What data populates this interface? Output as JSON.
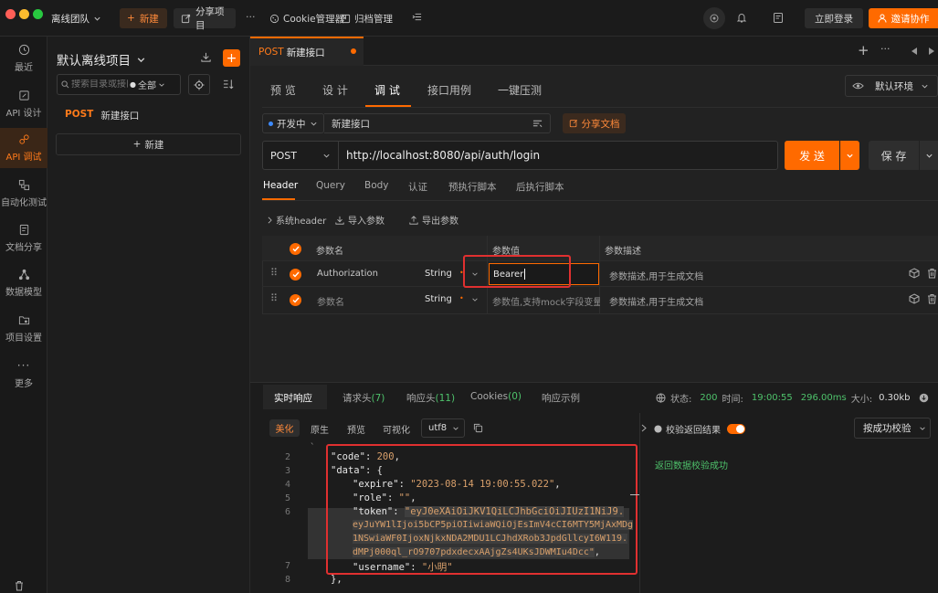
{
  "topbar": {
    "team": "离线团队",
    "new_btn": "新建",
    "share_project": "分享项目",
    "more": "···",
    "cookie_manager": "Cookie管理器",
    "archive_manager": "归档管理",
    "login": "立即登录",
    "invite": "邀请协作"
  },
  "colors": {
    "accent": "#ff6a00",
    "success": "#4ec26b",
    "highlight": "#e03030"
  },
  "nav": {
    "recent": "最近",
    "api_design": "API 设计",
    "api_debug": "API 调试",
    "auto_test": "自动化测试",
    "doc_share": "文档分享",
    "data_model": "数据模型",
    "project_settings": "项目设置",
    "more": "更多"
  },
  "tree": {
    "project": "默认离线项目",
    "search_placeholder": "搜索目录或接口",
    "filter": "全部",
    "method": "POST",
    "item": "新建接口",
    "new_btn": "新建"
  },
  "request_tab": {
    "method": "POST",
    "name": "新建接口"
  },
  "mode_tabs": {
    "preview": "预 览",
    "design": "设 计",
    "debug": "调 试",
    "case": "接口用例",
    "stress": "一键压测"
  },
  "env": "默认环境",
  "status": {
    "label": "开发中",
    "name": "新建接口",
    "share_doc": "分享文档"
  },
  "url_bar": {
    "method": "POST",
    "url": "http://localhost:8080/api/auth/login",
    "send": "发 送",
    "save": "保 存"
  },
  "req_tabs": {
    "header": "Header",
    "query": "Query",
    "body": "Body",
    "auth": "认证",
    "pre": "预执行脚本",
    "post": "后执行脚本"
  },
  "header_tools": {
    "system": "系统header",
    "import": "导入参数",
    "export": "导出参数"
  },
  "param_table": {
    "col_name": "参数名",
    "col_value": "参数值",
    "col_desc": "参数描述",
    "rows": [
      {
        "name": "Authorization",
        "type": "String",
        "value": "Bearer",
        "desc": "参数描述,用于生成文档"
      },
      {
        "name": "参数名",
        "type": "String",
        "value": "参数值,支持mock字段变量",
        "desc": "参数描述,用于生成文档"
      }
    ]
  },
  "resp_tabs": {
    "realtime": "实时响应",
    "req_headers": "请求头",
    "req_headers_count": "(7)",
    "resp_headers": "响应头",
    "resp_headers_count": "(11)",
    "cookies": "Cookies",
    "cookies_count": "(0)",
    "example": "响应示例"
  },
  "resp_status": {
    "status_label": "状态:",
    "status_value": "200",
    "time_label": "时间:",
    "time_value": "19:00:55",
    "duration": "296.00ms",
    "size_label": "大小:",
    "size_value": "0.30kb"
  },
  "view_tabs": {
    "pretty": "美化",
    "raw": "原生",
    "preview": "预览",
    "visual": "可视化",
    "encoding": "utf8"
  },
  "validate": {
    "label": "校验返回结果",
    "mode": "按成功校验",
    "result": "返回数据校验成功"
  },
  "code": {
    "line_numbers": [
      "2",
      "3",
      "4",
      "5",
      "6",
      "7",
      "8"
    ],
    "key_code": "\"code\"",
    "val_code": "200",
    "key_data": "\"data\"",
    "key_expire": "\"expire\"",
    "val_expire": "\"2023-08-14 19:00:55.022\"",
    "key_role": "\"role\"",
    "val_role": "\"\"",
    "key_token": "\"token\"",
    "token_lines": [
      "\"eyJ0eXAiOiJKV1QiLCJhbGciOiJIUzI1NiJ9.",
      "eyJuYW1lIjoi5bCP5piOIiwiaWQiOjEsImV4cCI6MTY5MjAxMDg",
      "1NSwiaWF0IjoxNjkxNDA2MDU1LCJhdXRob3JpdGllcyI6W119.",
      "dMPj000ql_rO9707pdxdecxAAjgZs4UKsJDWMIu4Dcc\""
    ],
    "key_username": "\"username\"",
    "val_username": "\"小明\""
  }
}
